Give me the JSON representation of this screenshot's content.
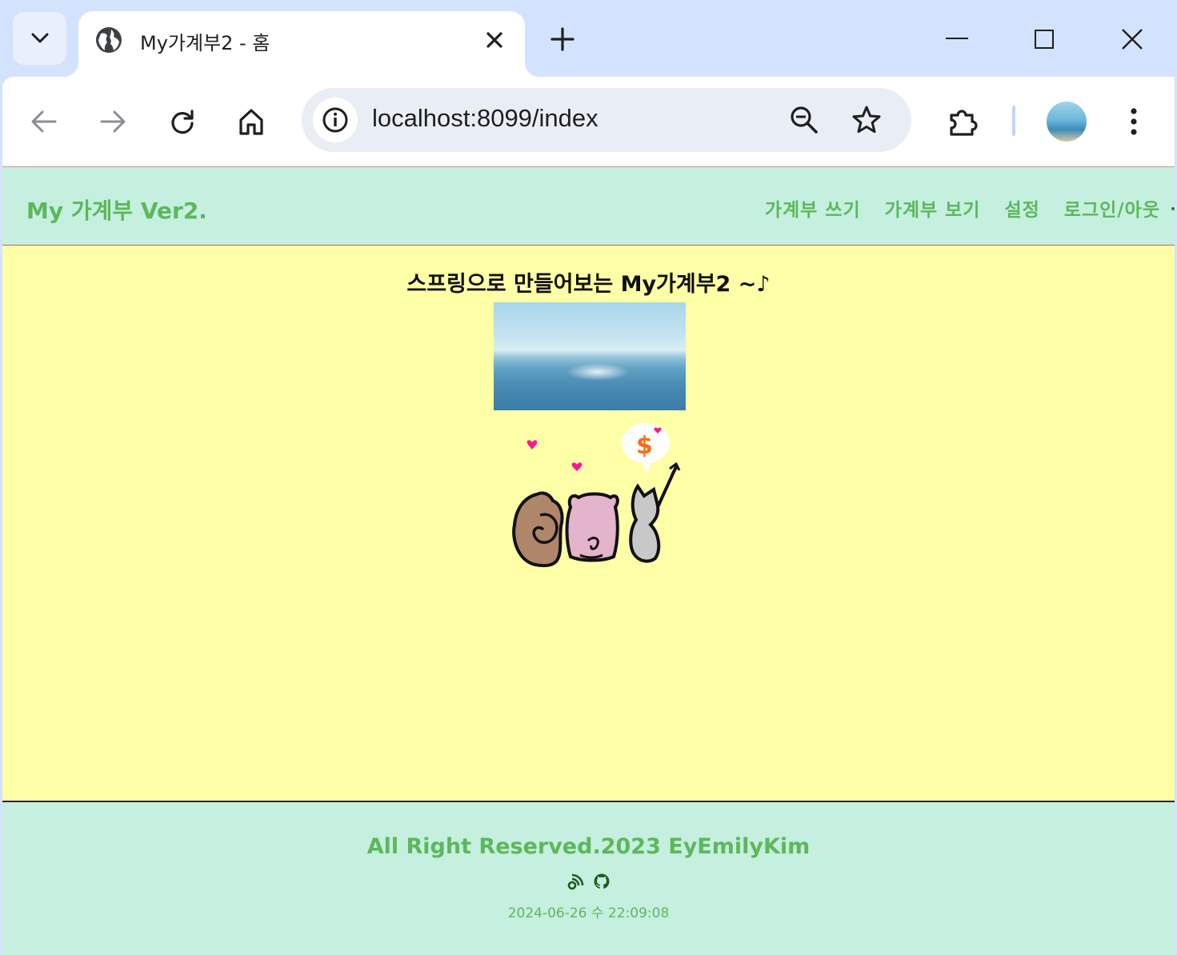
{
  "browser": {
    "tab_title": "My가계부2 - 홈",
    "url": "localhost:8099/index"
  },
  "site": {
    "brand": "My 가계부 Ver2.",
    "nav": [
      {
        "label": "가계부 쓰기"
      },
      {
        "label": "가계부 보기"
      },
      {
        "label": "설정"
      },
      {
        "label": "로그인/아웃"
      }
    ]
  },
  "main": {
    "headline": "스프링으로 만들어보는 My가계부2 ~♪"
  },
  "footer": {
    "copyright": "All Right Reserved.2023 EyEmilyKim",
    "icons": [
      "blog-icon",
      "github-icon"
    ],
    "datetime": "2024-06-26 수 22:09:08"
  },
  "colors": {
    "nav_bg": "#c5efdf",
    "accent_green": "#5cb85c",
    "main_bg": "#ffffa7",
    "chrome_bg": "#d3e3fd"
  }
}
